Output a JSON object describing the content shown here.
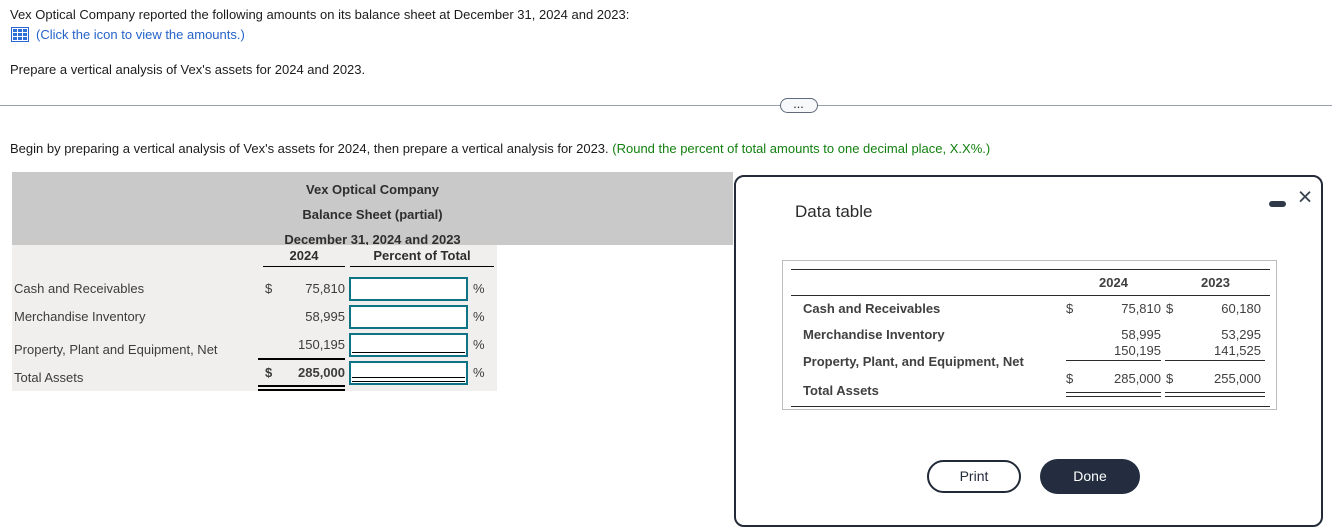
{
  "problem": {
    "intro": "Vex Optical Company reported the following amounts on its balance sheet at December 31, 2024 and 2023:",
    "icon_link": "(Click the icon to view the amounts.)",
    "task": "Prepare a vertical analysis of Vex's assets for 2024 and 2023.",
    "more_dots": "...",
    "instruction": "Begin by preparing a vertical analysis of Vex's assets for 2024, then prepare a vertical analysis for 2023. ",
    "instruction_note": "(Round the percent of total amounts to one decimal place, X.X%.)"
  },
  "worksheet": {
    "title1": "Vex Optical Company",
    "title2": "Balance Sheet (partial)",
    "title3": "December 31, 2024 and 2023",
    "col_year": "2024",
    "col_percent": "Percent of Total",
    "percent_sign": "%",
    "rows": [
      {
        "label": "Cash and Receivables",
        "dollar": "$",
        "amount": "75,810",
        "percent_value": ""
      },
      {
        "label": "Merchandise Inventory",
        "dollar": "",
        "amount": "58,995",
        "percent_value": ""
      },
      {
        "label": "Property, Plant and Equipment, Net",
        "dollar": "",
        "amount": "150,195",
        "percent_value": ""
      },
      {
        "label": "Total Assets",
        "dollar": "$",
        "amount": "285,000",
        "percent_value": ""
      }
    ]
  },
  "modal": {
    "title": "Data table",
    "close_glyph": "×",
    "table": {
      "col_2024": "2024",
      "col_2023": "2023",
      "rows": [
        {
          "label": "Cash and Receivables",
          "d1": "$",
          "v2024": "75,810",
          "d2": "$",
          "v2023": "60,180"
        },
        {
          "label": "Merchandise Inventory",
          "d1": "",
          "v2024": "58,995",
          "d2": "",
          "v2023": "53,295"
        },
        {
          "label": "Property, Plant, and Equipment, Net",
          "d1": "",
          "v2024": "150,195",
          "d2": "",
          "v2023": "141,525"
        },
        {
          "label": "Total Assets",
          "d1": "$",
          "v2024": "285,000",
          "d2": "$",
          "v2023": "255,000"
        }
      ]
    },
    "print_label": "Print",
    "done_label": "Done"
  },
  "colors": {
    "link_blue": "#2563c9",
    "note_green": "#12810f",
    "input_border_teal": "#0f7386",
    "worksheet_header_gray": "#c9c9c9",
    "worksheet_body_gray": "#f0efee",
    "modal_border": "#242b38",
    "done_button_bg": "#232d3f"
  }
}
